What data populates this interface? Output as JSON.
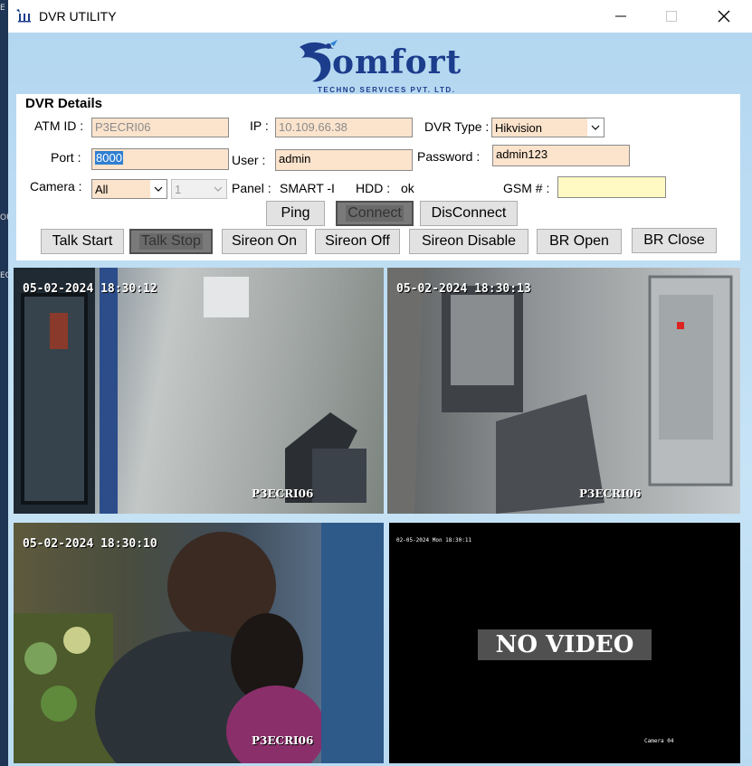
{
  "desktop": {
    "edge_labels": [
      "E",
      "OU",
      "EC"
    ]
  },
  "window": {
    "title": "DVR UTILITY",
    "icon": "app-logo-icon"
  },
  "logo": {
    "word": "omfort",
    "tagline": "TECHNO SERVICES PVT. LTD."
  },
  "details": {
    "title": "DVR Details",
    "atm_id": {
      "label": "ATM ID :",
      "value": "P3ECRI06"
    },
    "ip": {
      "label": "IP :",
      "value": "10.109.66.38"
    },
    "dvr_type": {
      "label": "DVR Type :",
      "value": "Hikvision"
    },
    "port": {
      "label": "Port :",
      "value": "8000"
    },
    "user": {
      "label": "User :",
      "value": "admin"
    },
    "password": {
      "label": "Password :",
      "value": "admin123"
    },
    "camera": {
      "label": "Camera :",
      "value": "All",
      "channel": "1"
    },
    "panel": {
      "label": "Panel :",
      "value": "SMART -I"
    },
    "hdd": {
      "label": "HDD :",
      "value": "ok"
    },
    "gsm": {
      "label": "GSM # :",
      "value": ""
    }
  },
  "buttons": {
    "ping": "Ping",
    "connect": "Connect",
    "disconnect": "DisConnect",
    "talk_start": "Talk Start",
    "talk_stop": "Talk Stop",
    "sireon_on": "Sireon On",
    "sireon_off": "Sireon Off",
    "sireon_disable": "Sireon Disable",
    "br_open": "BR Open",
    "br_close": "BR Close"
  },
  "cameras": [
    {
      "timestamp": "05-02-2024 18:30:12",
      "label": "P3ECRI06"
    },
    {
      "timestamp": "05-02-2024 18:30:13",
      "label": "P3ECRI06"
    },
    {
      "timestamp": "05-02-2024 18:30:10",
      "label": "P3ECRI06"
    },
    {
      "timestamp": "02-05-2024 Mon 18:30:11",
      "label": "Camera 04",
      "status": "NO VIDEO"
    }
  ],
  "colors": {
    "field_bg": "#fbe3cc",
    "window_bg": "#b8d9ef",
    "brand": "#1c3c8c",
    "gsm_bg": "#fff9c4"
  }
}
